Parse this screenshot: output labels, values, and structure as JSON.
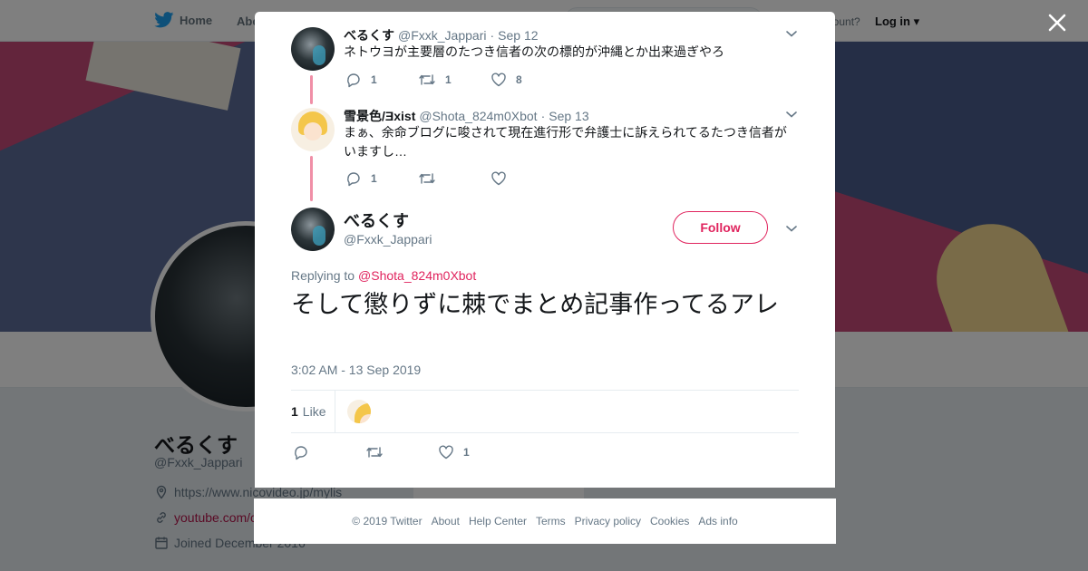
{
  "nav": {
    "home_label": "Home",
    "about_label": "Abo",
    "account_text": "account?",
    "login_label": "Log in"
  },
  "profile": {
    "name": "べるくす",
    "handle": "@Fxxk_Jappari",
    "url": "https://www.nicovideo.jp/mylis",
    "youtube": "youtube.com/c",
    "joined": "Joined December 2016",
    "ads_stub": "Ads info"
  },
  "thread": {
    "tweets": [
      {
        "name": "べるくす",
        "handle": "@Fxxk_Jappari",
        "date": "Sep 12",
        "text": "ネトウヨが主要層のたつき信者の次の標的が沖縄とか出来過ぎやろ",
        "replies": "1",
        "retweets": "1",
        "likes": "8"
      },
      {
        "name": "雪景色/Ǝxist",
        "handle": "@Shota_824m0Xbot",
        "date": "Sep 13",
        "text": "まぁ、余命ブログに唆されて現在進行形で弁護士に訴えられてるたつき信者がいますし…",
        "replies": "1",
        "retweets": "",
        "likes": ""
      }
    ],
    "main": {
      "name": "べるくす",
      "handle": "@Fxxk_Jappari",
      "follow_label": "Follow",
      "replying_prefix": "Replying to",
      "replying_to": "@Shota_824m0Xbot",
      "text": "そして懲りずに棘でまとめ記事作ってるアレ",
      "timestamp": "3:02 AM - 13 Sep 2019",
      "like_count": "1",
      "like_label": "Like",
      "action_likes": "1"
    }
  },
  "footer": {
    "copyright": "© 2019 Twitter",
    "links": [
      "About",
      "Help Center",
      "Terms",
      "Privacy policy",
      "Cookies",
      "Ads info"
    ]
  },
  "colors": {
    "accent": "#e0245e",
    "thread_line": "#f08fa7",
    "muted": "#657786",
    "twitter_blue": "#1da1f2"
  },
  "icons": [
    "twitter-bird-icon",
    "close-icon",
    "chevron-down-icon",
    "reply-icon",
    "retweet-icon",
    "heart-icon",
    "location-icon",
    "link-icon",
    "calendar-icon"
  ]
}
